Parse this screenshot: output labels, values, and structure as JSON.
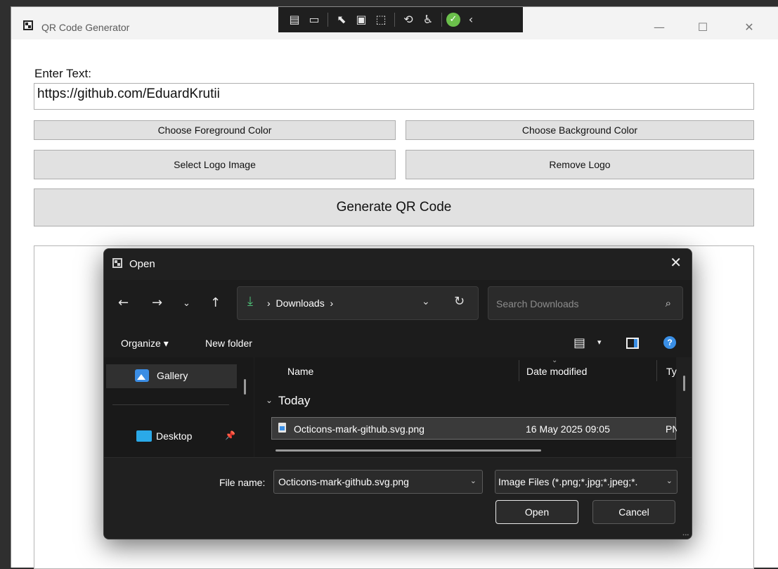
{
  "window": {
    "title": "QR Code Generator",
    "controls": {
      "minimize": "—",
      "maximize": "☐",
      "close": "✕"
    }
  },
  "debug_toolbar": {
    "icons": [
      "live-visual-tree-icon",
      "record-icon",
      "select-element-icon",
      "display-layout-adorners-icon",
      "track-focus-icon",
      "hot-reload-icon",
      "accessibility-icon",
      "binding-ok-icon",
      "collapse-icon"
    ]
  },
  "form": {
    "label": "Enter Text:",
    "text_value": "https://github.com/EduardKrutii",
    "buttons": {
      "foreground": "Choose Foreground Color",
      "background": "Choose Background Color",
      "select_logo": "Select Logo Image",
      "remove_logo": "Remove Logo",
      "generate": "Generate QR Code"
    }
  },
  "dialog": {
    "title": "Open",
    "close": "✕",
    "address": {
      "folder": "Downloads",
      "separator": "›"
    },
    "search_placeholder": "Search Downloads",
    "commands": {
      "organize": "Organize ▾",
      "new_folder": "New folder"
    },
    "nav_items": [
      {
        "label": "Gallery"
      },
      {
        "label": "Desktop"
      }
    ],
    "columns": {
      "name": "Name",
      "date": "Date modified",
      "type": "Ty"
    },
    "groups": [
      {
        "label": "Today",
        "files": [
          {
            "name": "Octicons-mark-github.svg.png",
            "date": "16 May 2025 09:05",
            "type": "PN"
          }
        ]
      }
    ],
    "file_name_label": "File name:",
    "file_name_value": "Octicons-mark-github.svg.png",
    "file_type_value": "Image Files (*.png;*.jpg;*.jpeg;*.",
    "open_label": "Open",
    "cancel_label": "Cancel"
  },
  "colors": {
    "dialog_bg": "#202020",
    "accent_blue": "#3a8fe6",
    "download_green": "#4fc37a",
    "button_gray": "#e1e1e1"
  }
}
